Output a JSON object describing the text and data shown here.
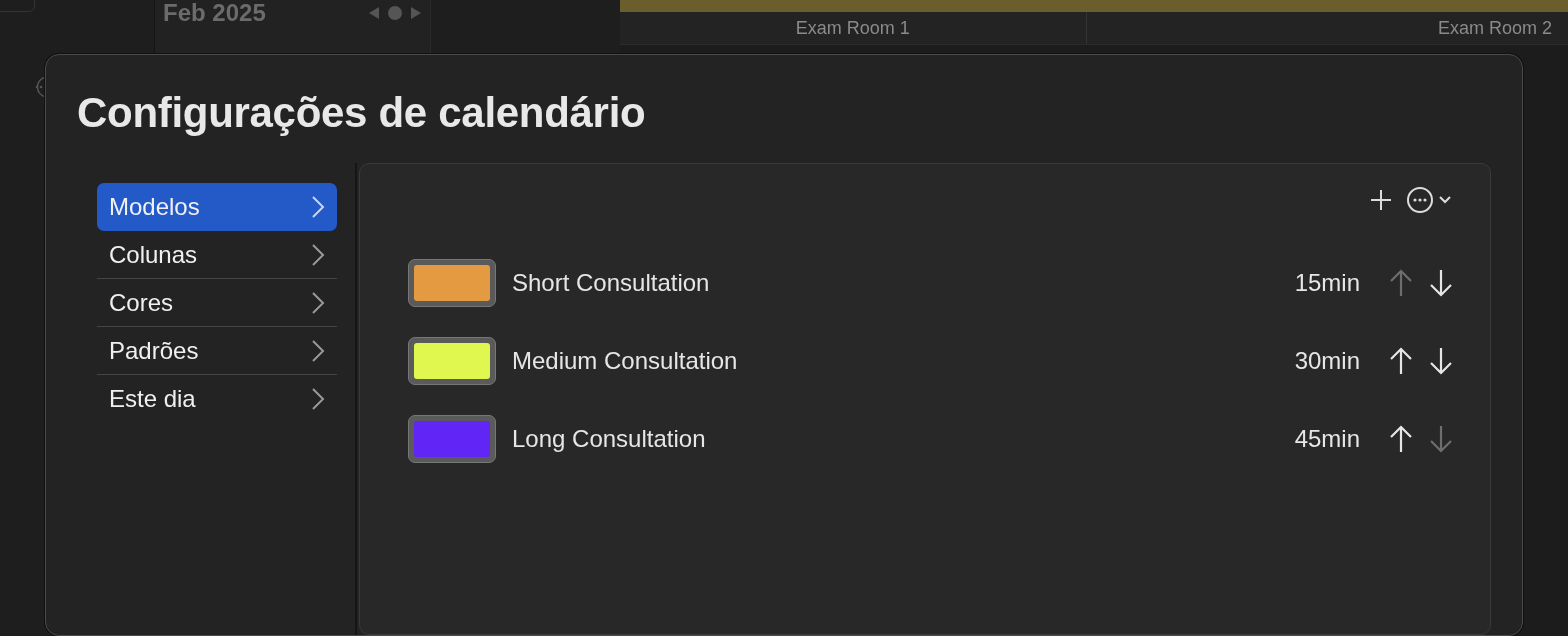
{
  "background": {
    "month": "Feb 2025",
    "columns": [
      "Exam Room 1",
      "Exam Room 2"
    ]
  },
  "dialog": {
    "title": "Configurações de calendário",
    "sidebar": {
      "items": [
        {
          "label": "Modelos",
          "selected": true
        },
        {
          "label": "Colunas",
          "selected": false
        },
        {
          "label": "Cores",
          "selected": false
        },
        {
          "label": "Padrões",
          "selected": false
        },
        {
          "label": "Este dia",
          "selected": false
        }
      ]
    },
    "templates": [
      {
        "name": "Short Consultation",
        "color": "#e49a40",
        "duration": "15min",
        "up_enabled": false,
        "down_enabled": true
      },
      {
        "name": "Medium Consultation",
        "color": "#dff74e",
        "duration": "30min",
        "up_enabled": true,
        "down_enabled": true
      },
      {
        "name": "Long Consultation",
        "color": "#6125f5",
        "duration": "45min",
        "up_enabled": true,
        "down_enabled": false
      }
    ]
  }
}
